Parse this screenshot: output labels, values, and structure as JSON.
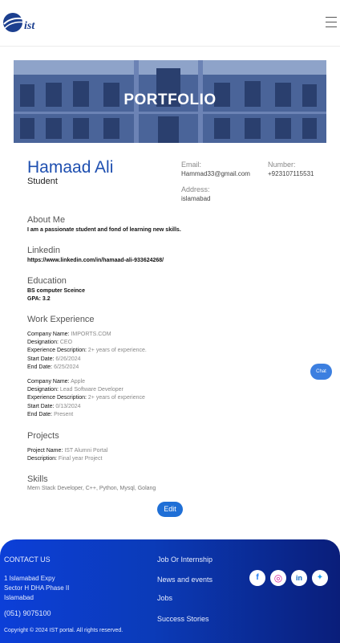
{
  "header": {
    "logo_text": "ist",
    "menu_icon": "hamburger-menu-icon"
  },
  "banner": {
    "title": "PORTFOLIO"
  },
  "profile": {
    "name": "Hamaad Ali",
    "role": "Student",
    "email_label": "Email:",
    "email": "Hammad33@gmail.com",
    "number_label": "Number:",
    "number": "+923107115531",
    "address_label": "Address:",
    "address": "islamabad"
  },
  "about": {
    "title": "About Me",
    "text": "I am a passionate student and fond of learning new skills."
  },
  "linkedin": {
    "title": "Linkedin",
    "url": "https://www.linkedin.com/in/hamaad-ali-933624268/"
  },
  "education": {
    "title": "Education",
    "degree": "BS computer Sceince",
    "gpa": "GPA: 3.2"
  },
  "work": {
    "title": "Work Experience",
    "labels": {
      "company": "Company Name:",
      "designation": "Designation:",
      "description": "Experience Description:",
      "start": "Start Date:",
      "end": "End Date:"
    },
    "items": [
      {
        "company": "IMPORTS.COM",
        "designation": "CEO",
        "description": "2+ years of experience.",
        "start": "6/26/2024",
        "end": "6/25/2024"
      },
      {
        "company": "Apple",
        "designation": "Lead Software Developer",
        "description": "2+ years of experience",
        "start": "0/13/2024",
        "end": "Present"
      }
    ]
  },
  "projects": {
    "title": "Projects",
    "name_label": "Project Name:",
    "name": "IST Alumni Portal",
    "desc_label": "Description:",
    "desc": "Final year Project"
  },
  "skills": {
    "title": "Skills",
    "text": "Mern Stack Developer, C++, Python, Mysql, Golang"
  },
  "buttons": {
    "chat": "Chat",
    "edit": "Edit"
  },
  "footer": {
    "contact_title": "CONTACT US",
    "address_lines": [
      "1 Islamabad Expy",
      "Sector H DHA Phase II",
      "Islamabad"
    ],
    "phone": "(051) 9075100",
    "copyright": "Copyright © 2024 IST portal. All rights reserved.",
    "links": [
      "Job Or Internship",
      "News and events",
      "Jobs",
      "Success Stories"
    ],
    "social": [
      "facebook-icon",
      "instagram-icon",
      "linkedin-icon",
      "twitter-icon"
    ]
  }
}
